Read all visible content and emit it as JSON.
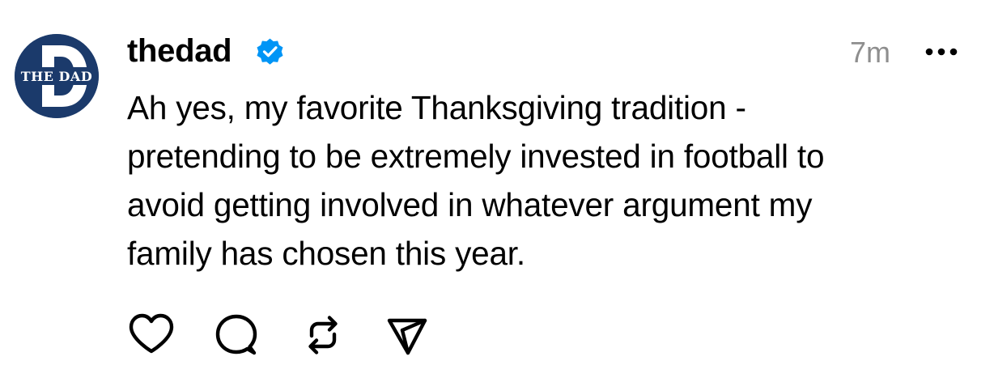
{
  "post": {
    "author": {
      "username": "thedad",
      "avatar_text": "THE DAD",
      "avatar_letter": "D",
      "avatar_color": "#1b3a6b",
      "verified": true,
      "verified_color": "#0095f6"
    },
    "timestamp": "7m",
    "text": "Ah yes, my favorite Thanksgiving tradition -\npretending to be extremely invested in football to\navoid getting involved in whatever argument my\nfamily has chosen this year.",
    "menu_icon": "more-horizontal-icon",
    "actions": [
      {
        "name": "like",
        "icon": "heart-icon"
      },
      {
        "name": "reply",
        "icon": "comment-icon"
      },
      {
        "name": "repost",
        "icon": "repost-icon"
      },
      {
        "name": "share",
        "icon": "send-icon"
      }
    ]
  }
}
